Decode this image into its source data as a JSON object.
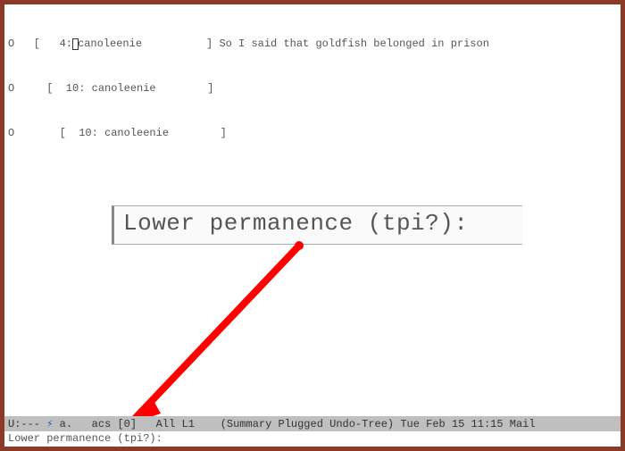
{
  "rows": [
    {
      "prefix": "O   [   4:",
      "user": "canoleenie",
      "suffix": "          ] So I said that goldfish belonged in prison"
    },
    {
      "prefix": "O     [  10: canoleenie        ]",
      "user": "",
      "suffix": ""
    },
    {
      "prefix": "O       [  10: canoleenie        ]",
      "user": "",
      "suffix": ""
    }
  ],
  "modeline": {
    "left": "U:--- ",
    "symbol": "⚡",
    "file": " a.   acs [0]",
    "rest": "   All L1    (Summary Plugged Undo-Tree) Tue Feb 15 11:15 Mail"
  },
  "minibuffer": {
    "prompt": "Lower permanence (tpi?):"
  },
  "callout": {
    "text": "Lower permanence (tpi?):"
  }
}
